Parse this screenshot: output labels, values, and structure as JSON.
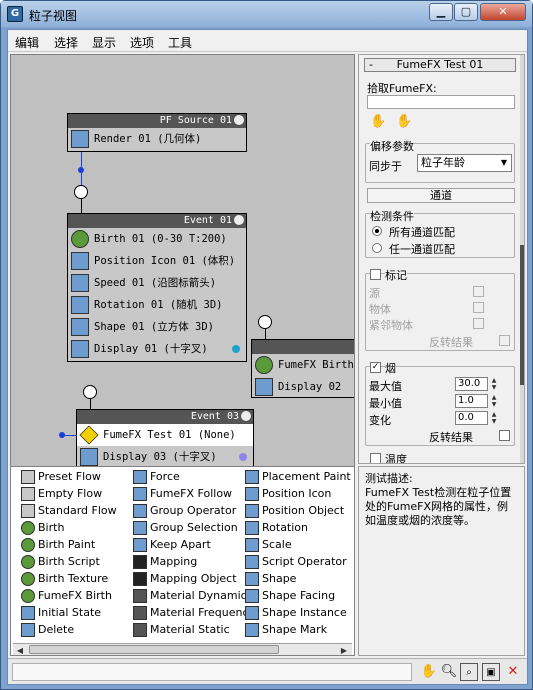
{
  "window": {
    "title": "粒子视图",
    "app_icon": "G"
  },
  "window_buttons": {
    "minimize": "▁",
    "maximize": "▢",
    "close": "✕"
  },
  "menu": [
    "编辑",
    "选择",
    "显示",
    "选项",
    "工具"
  ],
  "nodes": {
    "pf_source": {
      "header": "PF Source 01",
      "rows": [
        "Render 01 (几何体)"
      ]
    },
    "event01": {
      "header": "Event 01",
      "rows": [
        "Birth 01 (0-30 T:200)",
        "Position Icon 01 (体积)",
        "Speed 01 (沿图标箭头)",
        "Rotation 01 (随机 3D)",
        "Shape 01 (立方体 3D)",
        "Display 01 (十字叉)"
      ]
    },
    "event02": {
      "rows": [
        "FumeFX Birth",
        "Display 02"
      ]
    },
    "event03": {
      "header": "Event 03",
      "rows": [
        "FumeFX Test 01 (None)",
        "Display 03 (十字叉)"
      ]
    }
  },
  "right_panel": {
    "rollout_title": "FumeFX Test 01",
    "collapse_sign": "-",
    "pick_label": "拾取FumeFX:",
    "offset_group": "偏移参数",
    "sync_label": "同步于",
    "sync_value": "粒子年龄",
    "channel_button": "通道",
    "condition_group": "检测条件",
    "radio_all": "所有通道匹配",
    "radio_any": "任一通道匹配",
    "flag_label": "标记",
    "flag_items": [
      "源",
      "物体",
      "紧邻物体"
    ],
    "invert_label": "反转结果",
    "smoke_label": "烟",
    "max_label": "最大值",
    "max_value": "30.0",
    "min_label": "最小值",
    "min_value": "1.0",
    "change_label": "变化",
    "change_value": "0.0",
    "temp_label": "温度"
  },
  "description": {
    "title": "测试描述:",
    "text": "FumeFX Test检测在粒子位置处的FumeFX网格的属性，例如温度或烟的浓度等。"
  },
  "depot": {
    "col1": [
      "Preset Flow",
      "Empty Flow",
      "Standard Flow",
      "Birth",
      "Birth Paint",
      "Birth Script",
      "Birth Texture",
      "FumeFX Birth",
      "Initial State",
      "Delete"
    ],
    "col2": [
      "Force",
      "FumeFX Follow",
      "Group Operator",
      "Group Selection",
      "Keep Apart",
      "Mapping",
      "Mapping Object",
      "Material Dynamic",
      "Material Frequency",
      "Material Static"
    ],
    "col3": [
      "Placement Paint",
      "Position Icon",
      "Position Object",
      "Rotation",
      "Scale",
      "Script Operator",
      "Shape",
      "Shape Facing",
      "Shape Instance",
      "Shape Mark"
    ]
  },
  "colors": {
    "node_header": "#555555",
    "canvas_bg": "#c0c0c0",
    "wire_blue": "#1a3fd6",
    "dot_cyan": "#1fa3c8",
    "dot_violet": "#8f86e8",
    "test_yellow": "#f0d000"
  },
  "toolbar_icons": [
    "hand-icon",
    "zoom-icon",
    "zoom-region-icon",
    "zoom-extents-icon",
    "no-draw-icon"
  ]
}
